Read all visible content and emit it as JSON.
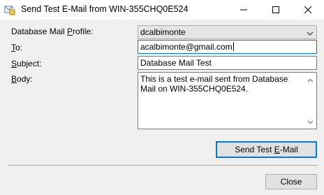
{
  "window": {
    "title": "Send Test E-Mail from WIN-355CHQ0E524"
  },
  "form": {
    "profile_label_pre": "Database Mail ",
    "profile_label_acc": "P",
    "profile_label_post": "rofile:",
    "profile_value": "dcalbimonte",
    "to_label_acc": "T",
    "to_label_post": "o:",
    "to_value": "acalbimonte@gmail.com",
    "subject_label_acc": "S",
    "subject_label_post": "ubject:",
    "subject_value": "Database Mail Test",
    "body_label_acc": "B",
    "body_label_post": "ody:",
    "body_value": "This is a test e-mail sent from Database Mail on WIN-355CHQ0E524."
  },
  "buttons": {
    "send_pre": "Send Test ",
    "send_acc": "E",
    "send_post": "-Mail",
    "close": "Close"
  },
  "icons": [
    "app-mail-icon",
    "minimize-icon",
    "maximize-icon",
    "close-icon",
    "chevron-down-icon",
    "scroll-up-icon",
    "scroll-down-icon"
  ]
}
